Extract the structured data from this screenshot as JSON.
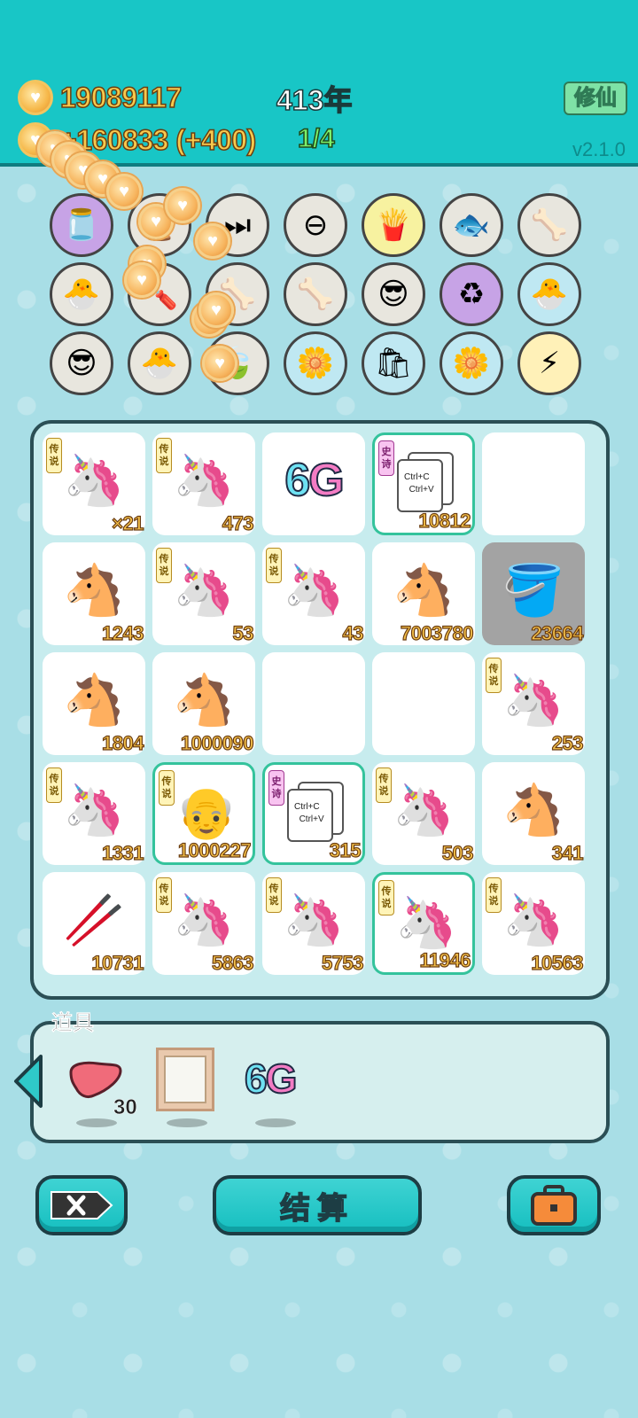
{
  "header": {
    "coins": "19089117",
    "income": "+160833 (+400)",
    "year": "413年",
    "progress": "1/4",
    "cultivate_label": "修仙",
    "version": "v2.1.0"
  },
  "upgrades": [
    {
      "icon": "milk-jar-icon",
      "glyph": "🫙",
      "bg": "#c7a3e6"
    },
    {
      "icon": "hourglass-icon",
      "glyph": "⏳",
      "bg": "#e8e6de"
    },
    {
      "icon": "fast-forward-icon",
      "glyph": "⏭",
      "bg": "#e8e6de"
    },
    {
      "icon": "minus-circle-icon",
      "glyph": "⊖",
      "bg": "#e8e6de"
    },
    {
      "icon": "fries-icon",
      "glyph": "🍟",
      "bg": "#f7f2a0"
    },
    {
      "icon": "fishbowl-icon",
      "glyph": "🐟",
      "bg": "#e8e6de"
    },
    {
      "icon": "pet-food-icon",
      "glyph": "🦴",
      "bg": "#e8e6de"
    },
    {
      "icon": "chick-egg-icon",
      "glyph": "🐣",
      "bg": "#e8e6de"
    },
    {
      "icon": "screwdriver-icon",
      "glyph": "🪛",
      "bg": "#e8e6de"
    },
    {
      "icon": "pet-food-icon",
      "glyph": "🦴",
      "bg": "#e8e6de"
    },
    {
      "icon": "pet-food-icon",
      "glyph": "🦴",
      "bg": "#e8e6de"
    },
    {
      "icon": "sunglasses-cats-icon",
      "glyph": "😎",
      "bg": "#e8e6de"
    },
    {
      "icon": "recycle-icon",
      "glyph": "♻",
      "bg": "#c7a3e6"
    },
    {
      "icon": "chick-egg-icon",
      "glyph": "🐣",
      "bg": "#bfe8f2"
    },
    {
      "icon": "sunglasses-cats-icon",
      "glyph": "😎",
      "bg": "#e8e6de"
    },
    {
      "icon": "chick-egg-icon",
      "glyph": "🐣",
      "bg": "#e8e6de"
    },
    {
      "icon": "leaf-icon",
      "glyph": "🍃",
      "bg": "#e8e6de"
    },
    {
      "icon": "flower-pot-icon",
      "glyph": "🌼",
      "bg": "#bfe8f2"
    },
    {
      "icon": "trash-bag-icon",
      "glyph": "🛍",
      "bg": "#bfe8f2"
    },
    {
      "icon": "flower-pot-icon",
      "glyph": "🌼",
      "bg": "#bfe8f2"
    },
    {
      "icon": "lightning-icon",
      "glyph": "⚡",
      "bg": "#fff1b8"
    }
  ],
  "grid": [
    {
      "icon": "unicorn-icon",
      "glyph": "🦄",
      "tag": "legend",
      "num": "×21"
    },
    {
      "icon": "unicorn-icon",
      "glyph": "🦄",
      "tag": "legend",
      "num": "473"
    },
    {
      "icon": "sixg-icon",
      "glyph": "",
      "tag": "",
      "num": ""
    },
    {
      "icon": "ctrl-cv-icon",
      "glyph": "",
      "tag": "epic",
      "num": "10812",
      "hl": true
    },
    {
      "icon": "",
      "glyph": "",
      "tag": "",
      "num": ""
    },
    {
      "icon": "horse-icon",
      "glyph": "🐴",
      "tag": "",
      "num": "1243"
    },
    {
      "icon": "unicorn-icon",
      "glyph": "🦄",
      "tag": "legend",
      "num": "53"
    },
    {
      "icon": "unicorn-icon",
      "glyph": "🦄",
      "tag": "legend",
      "num": "43"
    },
    {
      "icon": "horse-icon",
      "glyph": "🐴",
      "tag": "",
      "num": "7003780"
    },
    {
      "icon": "bucket-icon",
      "glyph": "🪣",
      "tag": "",
      "num": "23664",
      "dark": true
    },
    {
      "icon": "horse-icon",
      "glyph": "🐴",
      "tag": "",
      "num": "1804"
    },
    {
      "icon": "horse-icon",
      "glyph": "🐴",
      "tag": "",
      "num": "1000090"
    },
    {
      "icon": "",
      "glyph": "",
      "tag": "",
      "num": ""
    },
    {
      "icon": "",
      "glyph": "",
      "tag": "",
      "num": ""
    },
    {
      "icon": "unicorn-icon",
      "glyph": "🦄",
      "tag": "legend",
      "num": "253"
    },
    {
      "icon": "unicorn-icon",
      "glyph": "🦄",
      "tag": "legend",
      "num": "1331"
    },
    {
      "icon": "bald-man-icon",
      "glyph": "👴",
      "tag": "legend",
      "num": "1000227",
      "hl": true
    },
    {
      "icon": "ctrl-cv-icon",
      "glyph": "",
      "tag": "epic",
      "num": "315",
      "hl": true
    },
    {
      "icon": "unicorn-icon",
      "glyph": "🦄",
      "tag": "legend",
      "num": "503"
    },
    {
      "icon": "horse-icon",
      "glyph": "🐴",
      "tag": "",
      "num": "341"
    },
    {
      "icon": "straw-icon",
      "glyph": "🥢",
      "tag": "",
      "num": "10731"
    },
    {
      "icon": "unicorn-icon",
      "glyph": "🦄",
      "tag": "legend",
      "num": "5863"
    },
    {
      "icon": "unicorn-icon",
      "glyph": "🦄",
      "tag": "legend",
      "num": "5753"
    },
    {
      "icon": "crowned-unicorn-icon",
      "glyph": "🦄",
      "tag": "legend",
      "num": "11946",
      "hl": true
    },
    {
      "icon": "unicorn-icon",
      "glyph": "🦄",
      "tag": "legend",
      "num": "10563"
    }
  ],
  "tags": {
    "legend": [
      "传",
      "说"
    ],
    "epic": [
      "史",
      "诗"
    ]
  },
  "sixg": {
    "six": "6",
    "g": "G"
  },
  "ctrl_text": {
    "c": "Ctrl+C",
    "v": "Ctrl+V"
  },
  "items": {
    "label": "道具",
    "list": [
      {
        "icon": "liver-icon",
        "glyph": "🫀",
        "count": "30"
      },
      {
        "icon": "picture-frame-icon",
        "glyph": "",
        "count": ""
      },
      {
        "icon": "sixg-icon",
        "glyph": "",
        "count": ""
      }
    ]
  },
  "buttons": {
    "settle_label": "结算"
  }
}
